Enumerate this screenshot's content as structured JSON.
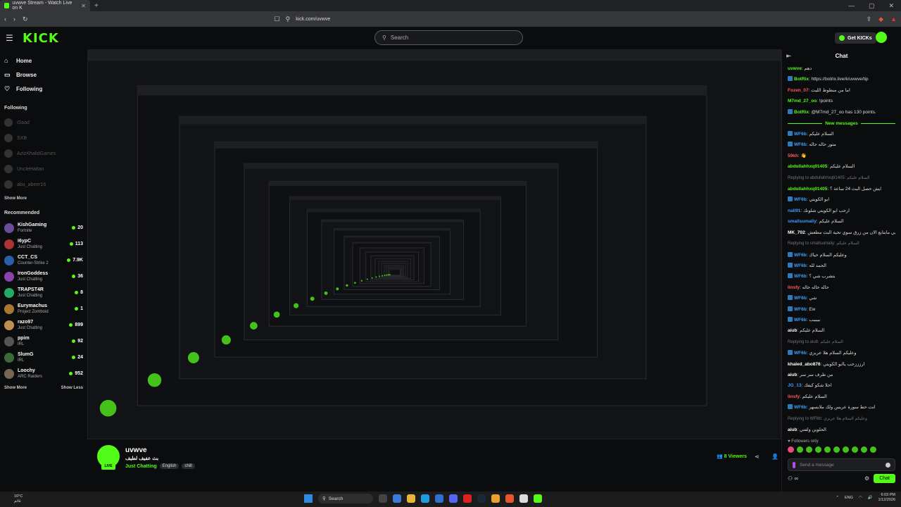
{
  "browser": {
    "tab_title": "uvwve Stream - Watch Live on K",
    "url": "kick.com/uvwve"
  },
  "header": {
    "logo": "KICK",
    "search_placeholder": "Search",
    "get_kicks": "Get KICKs"
  },
  "sidebar": {
    "nav": [
      {
        "label": "Home",
        "icon": "home-icon"
      },
      {
        "label": "Browse",
        "icon": "browse-icon"
      },
      {
        "label": "Following",
        "icon": "heart-icon"
      }
    ],
    "following_title": "Following",
    "following": [
      "iSaad",
      "SXB",
      "AzizKhalidGames",
      "UncleHattan",
      "abu_abeer16"
    ],
    "show_more": "Show More",
    "recommended_title": "Recommended",
    "recommended": [
      {
        "name": "KishGaming",
        "category": "Fortnite",
        "viewers": "20",
        "color": "#6a4b9c"
      },
      {
        "name": "I6ypC",
        "category": "Just Chatting",
        "viewers": "113",
        "color": "#aa3333"
      },
      {
        "name": "CCT_CS",
        "category": "Counter-Strike 2",
        "viewers": "7.9K",
        "color": "#2a5fa8"
      },
      {
        "name": "IronGoddess",
        "category": "Just Chatting",
        "viewers": "36",
        "color": "#8844aa"
      },
      {
        "name": "TRAPST4R",
        "category": "Just Chatting",
        "viewers": "8",
        "color": "#22aa66"
      },
      {
        "name": "Eurymachus",
        "category": "Project Zomboid",
        "viewers": "1",
        "color": "#aa7733"
      },
      {
        "name": "razo97",
        "category": "Just Chatting",
        "viewers": "899",
        "color": "#c09050"
      },
      {
        "name": "ppim",
        "category": "IRL",
        "viewers": "92",
        "color": "#555555"
      },
      {
        "name": "SlumG",
        "category": "IRL",
        "viewers": "24",
        "color": "#3a6a3a"
      },
      {
        "name": "Loochy",
        "category": "ARC Raiders",
        "viewers": "952",
        "color": "#776655"
      }
    ],
    "show_more_bottom": "Show More",
    "show_less": "Show Less"
  },
  "stream": {
    "username": "uvwve",
    "title": "بث عفيف لطيف",
    "category": "Just Chatting",
    "tags": [
      "English",
      "chill"
    ],
    "live_badge": "LIVE",
    "viewers": "8 Viewers"
  },
  "chat": {
    "title": "Chat",
    "messages": [
      {
        "user": "uvwve",
        "text": "دهم",
        "color": "#53fc18",
        "badge": false
      },
      {
        "user": "BotRix",
        "text": "https://botrix.live/k/uvwve/tip",
        "color": "#53fc18",
        "badge": true
      },
      {
        "user": "Fozen_07",
        "text": "اما من منطوط الليت",
        "color": "#ff5b5b",
        "badge": false
      },
      {
        "user": "M7md_27_oo",
        "text": "!points",
        "color": "#53fc18",
        "badge": false
      },
      {
        "user": "BotRix",
        "text": "@M7md_27_oo has 130 points.",
        "color": "#53fc18",
        "badge": true
      }
    ],
    "new_messages": "New messages",
    "messages2": [
      {
        "user": "WF6b",
        "text": "السلام عليكم",
        "color": "#3aa0ff",
        "badge": true
      },
      {
        "user": "WF6b",
        "text": "منور حاله حاله",
        "color": "#3aa0ff",
        "badge": true
      },
      {
        "user": "59kh",
        "text": "👋",
        "color": "#ff5b5b",
        "badge": false
      },
      {
        "user": "abdullahhxq91405",
        "text": "السلام عليكم",
        "color": "#53fc18",
        "badge": false
      },
      {
        "user": "",
        "text": "Replying to abdullahhxq91405: السلام عليكم",
        "color": "#777777",
        "badge": false,
        "reply": true
      },
      {
        "user": "abdullahhxq91405",
        "text": "ايش حصل البث 24 ساعة ؟",
        "color": "#53fc18",
        "badge": false
      },
      {
        "user": "WF6b",
        "text": "ابو الكويتي",
        "color": "#3aa0ff",
        "badge": true
      },
      {
        "user": "nall91",
        "text": "ارحب ابو الكويتي شلونك",
        "color": "#3aa0ff",
        "badge": false
      },
      {
        "user": "smallsumaliy",
        "text": "السلام عليكم",
        "color": "#3aa0ff",
        "badge": false
      },
      {
        "user": "MK_702",
        "text": "اعتزيي مابتابع الان من زرق سوي تحية البث مطعش",
        "color": "#ffffff",
        "badge": false
      },
      {
        "user": "",
        "text": "Replying to smallsumaliy: السلام عليكم",
        "color": "#777777",
        "badge": false,
        "reply": true
      },
      {
        "user": "WF6b",
        "text": "وعليكم السلام حياك",
        "color": "#3aa0ff",
        "badge": true
      },
      {
        "user": "WF6b",
        "text": "الحمد لله",
        "color": "#3aa0ff",
        "badge": true
      },
      {
        "user": "WF6b",
        "text": "بتشرب شي ؟",
        "color": "#3aa0ff",
        "badge": true
      },
      {
        "user": "linsfy",
        "text": "حاله حاله حاله",
        "color": "#ff5b5b",
        "badge": false
      },
      {
        "user": "WF6b",
        "text": "شي",
        "color": "#3aa0ff",
        "badge": true
      },
      {
        "user": "WF6b",
        "text": "Ew",
        "color": "#3aa0ff",
        "badge": true
      },
      {
        "user": "WF6b",
        "text": "بببببب",
        "color": "#3aa0ff",
        "badge": true
      },
      {
        "user": "aiub",
        "text": "السلام عليكم",
        "color": "#ffffff",
        "badge": false
      },
      {
        "user": "",
        "text": "Replying to aiub: السلام عليكم",
        "color": "#777777",
        "badge": false,
        "reply": true
      },
      {
        "user": "WF6b",
        "text": "وعليكم السلام هلا عزيزي",
        "color": "#3aa0ff",
        "badge": true
      },
      {
        "user": "khaled_abo876",
        "text": "ارزززحب ياابو الكويتي",
        "color": "#ffffff",
        "badge": false
      },
      {
        "user": "aiub",
        "text": "من طرف سر سر",
        "color": "#ffffff",
        "badge": false
      },
      {
        "user": "JG_13",
        "text": "احلا شكو كيفك",
        "color": "#3aa0ff",
        "badge": false
      },
      {
        "user": "linsfy",
        "text": "السلام عليكم",
        "color": "#ff5b5b",
        "badge": false
      },
      {
        "user": "WF6b",
        "text": "انت حط سورة عربس ولك ملابسهر",
        "color": "#3aa0ff",
        "badge": true
      },
      {
        "user": "",
        "text": "Replying to WF6b: وعليكم السلام هلا عزيزي",
        "color": "#777777",
        "badge": false,
        "reply": true
      },
      {
        "user": "aiub",
        "text": "الحلوين ولفتي",
        "color": "#ffffff",
        "badge": false
      }
    ],
    "followers_only": "Followers only",
    "input_placeholder": "Send a message",
    "points": "∞",
    "chat_button": "Chat"
  },
  "taskbar": {
    "temp": "10°C",
    "weather": "غائم",
    "search": "Search",
    "lang": "ENG",
    "time": "6:03 PM",
    "date": "1/12/2026"
  }
}
